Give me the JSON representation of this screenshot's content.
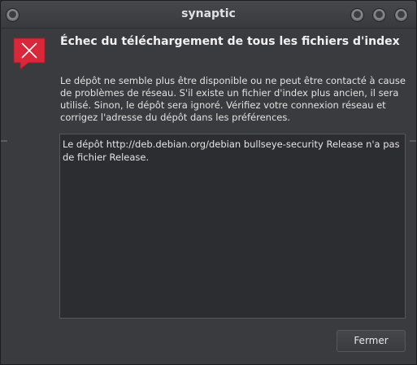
{
  "window": {
    "title": "synaptic"
  },
  "dialog": {
    "icon": "error-icon",
    "heading": "Échec du téléchargement de tous les fichiers d'index",
    "message": "Le dépôt ne semble plus être disponible ou ne peut être contacté à cause de problèmes de réseau. S'il existe un fichier d'index plus ancien, il sera utilisé. Sinon, le dépôt sera ignoré. Vérifiez votre connexion réseau et corrigez l'adresse du dépôt dans les préférences.",
    "details": "Le dépôt http://deb.debian.org/debian bullseye-security Release n'a pas de fichier Release.",
    "close_label": "Fermer"
  },
  "colors": {
    "accent_error": "#d8283a",
    "background": "#393b3e",
    "text": "#e2e2e2"
  }
}
